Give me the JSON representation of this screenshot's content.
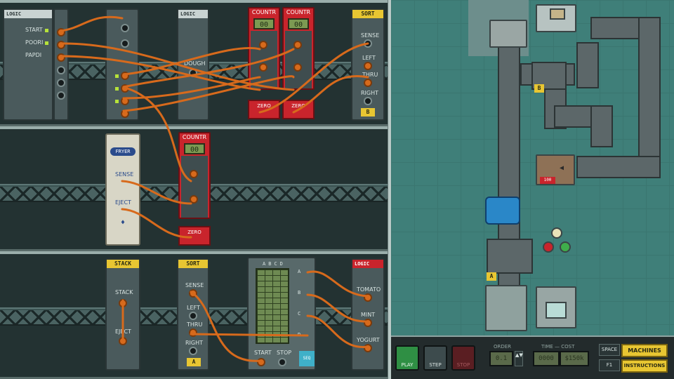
{
  "rack1": {
    "logic_label": "LOGIC",
    "start_label": "START",
    "poori_label": "POORI",
    "papdi_label": "PAPDI",
    "logic2_label": "LOGIC",
    "dough_label": "DOUGH"
  },
  "counters": [
    {
      "title": "COUNTR",
      "value": "00",
      "zero": "ZERO"
    },
    {
      "title": "COUNTR",
      "value": "00",
      "zero": "ZERO"
    },
    {
      "title": "COUNTR",
      "value": "00",
      "zero": "ZERO"
    }
  ],
  "sort_top": {
    "title": "SORT",
    "sense": "SENSE",
    "left": "LEFT",
    "thru": "THRU",
    "right": "RIGHT",
    "tag": "B"
  },
  "fryer": {
    "title": "FRYER",
    "sense": "SENSE",
    "eject": "EJECT"
  },
  "stack": {
    "title": "STACK",
    "stack_label": "STACK",
    "eject_label": "EJECT"
  },
  "sort_bottom": {
    "title": "SORT",
    "sense": "SENSE",
    "left": "LEFT",
    "thru": "THRU",
    "right": "RIGHT",
    "tag": "A"
  },
  "sequencer": {
    "cols": [
      "A",
      "B",
      "C",
      "D"
    ],
    "rows": [
      "A",
      "B",
      "C",
      "D"
    ],
    "start": "START",
    "stop": "STOP",
    "badge": "SEQ"
  },
  "logic_bottom": {
    "title": "LOGIC",
    "tomato": "TOMATO",
    "mint": "MINT",
    "yogurt": "YOGURT"
  },
  "factory": {
    "tag_b": "B",
    "tag_a": "A",
    "display": "100"
  },
  "controls": {
    "play": "PLAY",
    "step": "STEP",
    "stop": "STOP",
    "order_label": "ORDER",
    "order_value": "0.1",
    "time_cost_label": "TIME — COST",
    "time_value": "0000",
    "cost_value": "$150k",
    "space_key": "SPACE",
    "machines_btn": "MACHINES",
    "f1_key": "F1",
    "instructions_btn": "INSTRUCTIONS"
  },
  "colors": {
    "accent": "#e8c632",
    "counter_red": "#c9242c",
    "wire_orange": "#d76a1c",
    "play_green": "#2f8f44"
  }
}
